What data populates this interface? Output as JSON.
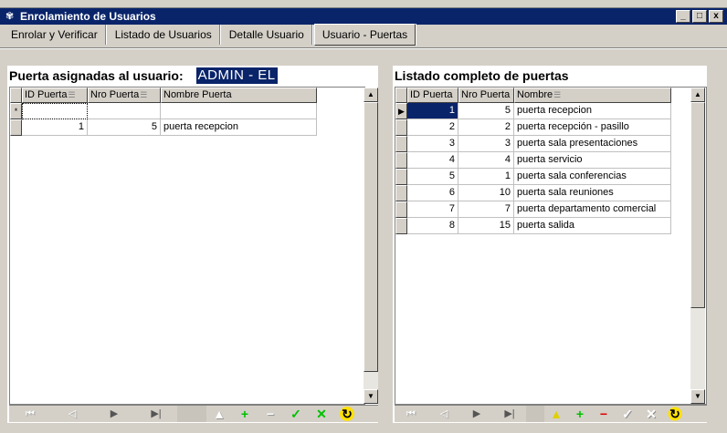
{
  "window": {
    "title": "Enrolamiento de Usuarios",
    "minimize": "_",
    "maximize": "□",
    "close": "x"
  },
  "tabs": [
    {
      "label": "Enrolar y Verificar"
    },
    {
      "label": "Listado de Usuarios"
    },
    {
      "label": "Detalle Usuario"
    },
    {
      "label": "Usuario - Puertas"
    }
  ],
  "left": {
    "title": "Puerta asignadas al usuario:",
    "user": "ADMIN - EL",
    "columns": [
      "ID Puerta",
      "Nro Puerta",
      "Nombre Puerta"
    ],
    "new_row_marker": "*",
    "rows": [
      {
        "id": "1",
        "nro": "5",
        "nombre": "puerta recepcion"
      }
    ]
  },
  "right": {
    "title": "Listado completo de puertas",
    "columns": [
      "ID Puerta",
      "Nro Puerta",
      "Nombre"
    ],
    "current_row_marker": "▶",
    "rows": [
      {
        "id": "1",
        "nro": "5",
        "nombre": "puerta recepcion"
      },
      {
        "id": "2",
        "nro": "2",
        "nombre": "puerta recepción - pasillo"
      },
      {
        "id": "3",
        "nro": "3",
        "nombre": "puerta sala presentaciones"
      },
      {
        "id": "4",
        "nro": "4",
        "nombre": "puerta servicio"
      },
      {
        "id": "5",
        "nro": "1",
        "nombre": "puerta sala conferencias"
      },
      {
        "id": "6",
        "nro": "10",
        "nombre": "puerta sala reuniones"
      },
      {
        "id": "7",
        "nro": "7",
        "nombre": "puerta departamento comercial"
      },
      {
        "id": "8",
        "nro": "15",
        "nombre": "puerta salida"
      }
    ]
  },
  "navigator": {
    "first": "⏮",
    "prior": "◁",
    "next": "▶",
    "last": "▶|",
    "insert": "+",
    "delete": "−",
    "post": "✓",
    "cancel": "✕",
    "refresh": "↻",
    "edit": "▲"
  },
  "colors": {
    "titlebar": "#0a246a",
    "selection": "#0a246a",
    "face": "#d4d0c8",
    "insert": "#00c000",
    "delete": "#e00000",
    "edit": "#e0d000"
  }
}
